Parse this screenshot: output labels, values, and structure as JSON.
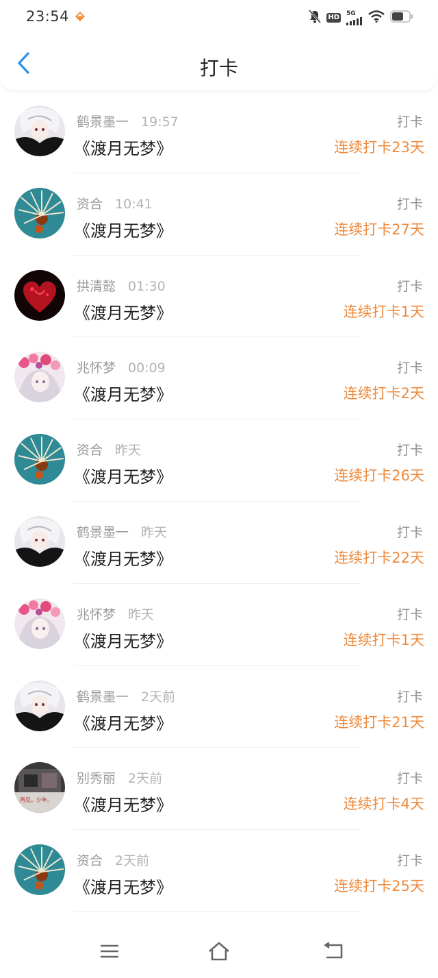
{
  "status_bar": {
    "time": "23:54",
    "hd": "HD",
    "network": "5G",
    "icons": [
      "app-notification-icon",
      "bell-off-icon",
      "signal-icon",
      "wifi-icon",
      "battery-icon"
    ]
  },
  "header": {
    "title": "打卡",
    "back_icon": "chevron-left-icon"
  },
  "colors": {
    "accent_blue": "#2f8fe8",
    "streak_orange": "#ef8a3c",
    "muted_gray": "#9b9b9b"
  },
  "checkins": [
    {
      "user": "鹤景墨一",
      "time": "19:57",
      "book": "《渡月无梦》",
      "action": "打卡",
      "streak": "连续打卡23天",
      "avatar": "anime-boy-white-hair"
    },
    {
      "user": "资合",
      "time": "10:41",
      "book": "《渡月无梦》",
      "action": "打卡",
      "streak": "连续打卡27天",
      "avatar": "sea-creature"
    },
    {
      "user": "拱清懿",
      "time": "01:30",
      "book": "《渡月无梦》",
      "action": "打卡",
      "streak": "连续打卡1天",
      "avatar": "red-heart"
    },
    {
      "user": "兆怀梦",
      "time": "00:09",
      "book": "《渡月无梦》",
      "action": "打卡",
      "streak": "连续打卡2天",
      "avatar": "anime-girl-flowers"
    },
    {
      "user": "资合",
      "time": "昨天",
      "book": "《渡月无梦》",
      "action": "打卡",
      "streak": "连续打卡26天",
      "avatar": "sea-creature"
    },
    {
      "user": "鹤景墨一",
      "time": "昨天",
      "book": "《渡月无梦》",
      "action": "打卡",
      "streak": "连续打卡22天",
      "avatar": "anime-boy-white-hair"
    },
    {
      "user": "兆怀梦",
      "time": "昨天",
      "book": "《渡月无梦》",
      "action": "打卡",
      "streak": "连续打卡1天",
      "avatar": "anime-girl-flowers"
    },
    {
      "user": "鹤景墨一",
      "time": "2天前",
      "book": "《渡月无梦》",
      "action": "打卡",
      "streak": "连续打卡21天",
      "avatar": "anime-boy-white-hair"
    },
    {
      "user": "别秀丽",
      "time": "2天前",
      "book": "《渡月无梦》",
      "action": "打卡",
      "streak": "连续打卡4天",
      "avatar": "dark-room-photo"
    },
    {
      "user": "资合",
      "time": "2天前",
      "book": "《渡月无梦》",
      "action": "打卡",
      "streak": "连续打卡25天",
      "avatar": "sea-creature"
    }
  ],
  "nav_bar": {
    "icons": [
      "menu-icon",
      "home-icon",
      "back-icon"
    ]
  }
}
